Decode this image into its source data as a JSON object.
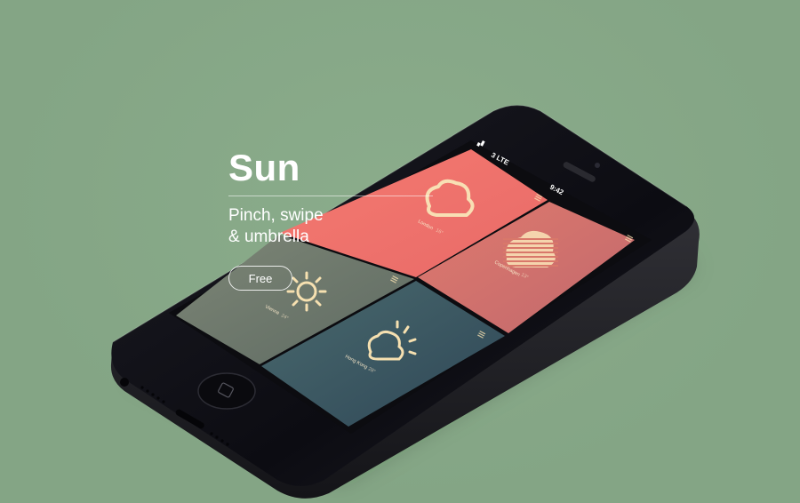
{
  "hero": {
    "title": "Sun",
    "subtitle_line1": "Pinch, swipe",
    "subtitle_line2": "& umbrella",
    "cta_label": "Free"
  },
  "status_bar": {
    "carrier": "3 LTE",
    "time": "9:42"
  },
  "tiles": [
    {
      "city": "London",
      "temp": "16°",
      "icon": "cloud-icon",
      "color": "#f0706a"
    },
    {
      "city": "Copenhagen",
      "temp": "13°",
      "icon": "rain-cloud-icon",
      "color": "#d9786a"
    },
    {
      "city": "Vienna",
      "temp": "24°",
      "icon": "sun-icon",
      "color": "#6a7a6a"
    },
    {
      "city": "Hong Kong",
      "temp": "28°",
      "icon": "partly-sunny-icon",
      "color": "#3f5b66"
    }
  ],
  "colors": {
    "background": "#84a585",
    "phone_body": "#121218",
    "icon_stroke": "#f6e0b0"
  }
}
